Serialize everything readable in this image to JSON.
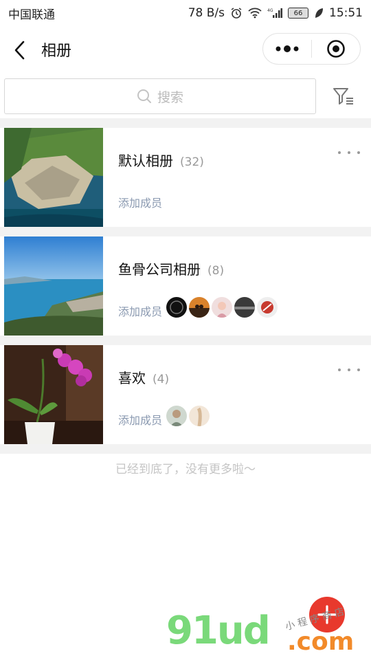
{
  "status_bar": {
    "carrier": "中国联通",
    "speed": "78 B/s",
    "battery": "66",
    "time": "15:51"
  },
  "nav": {
    "title": "相册"
  },
  "search": {
    "placeholder": "搜索"
  },
  "albums": [
    {
      "name": "默认相册",
      "count": "(32)",
      "add_member": "添加成员",
      "avatars": 0,
      "has_more": true
    },
    {
      "name": "鱼骨公司相册",
      "count": "(8)",
      "add_member": "添加成员",
      "avatars": 5,
      "has_more": false
    },
    {
      "name": "喜欢",
      "count": "(4)",
      "add_member": "添加成员",
      "avatars": 2,
      "has_more": true
    }
  ],
  "end_message": "已经到底了，没有更多啦～",
  "watermark": {
    "main": "91ud",
    "suffix": ".com",
    "small": "小 程 序 商 店"
  },
  "colors": {
    "accent": "#e8392d",
    "link": "#8a99b0",
    "muted": "#999999"
  }
}
